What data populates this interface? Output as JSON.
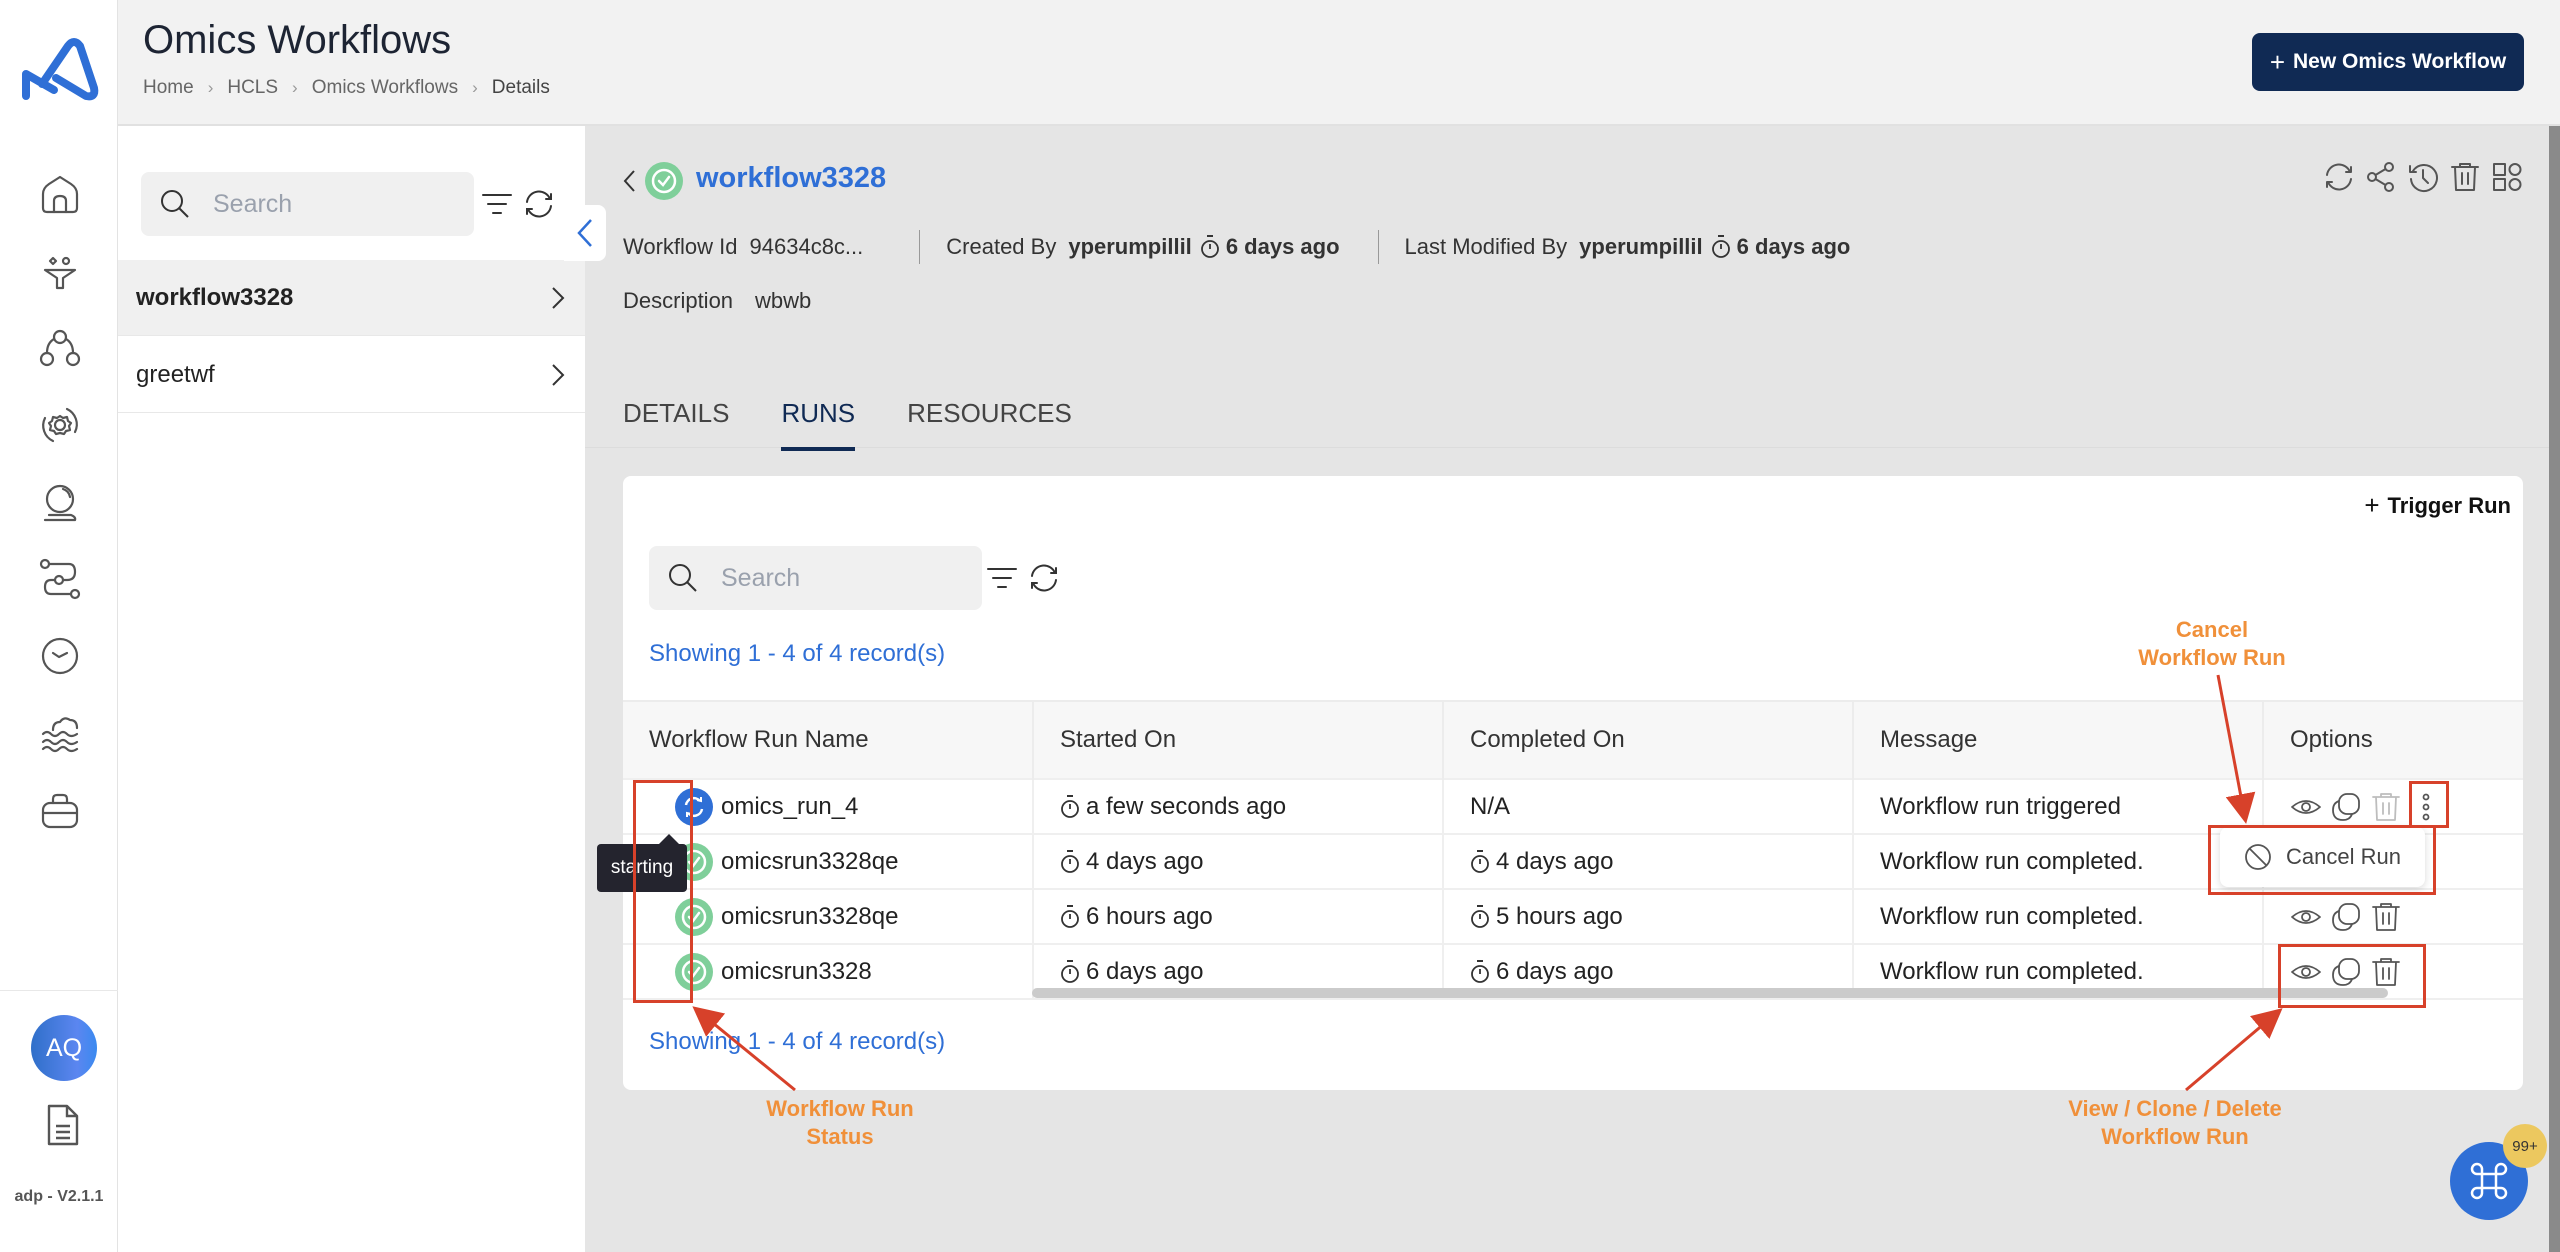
{
  "app": {
    "version": "adp - V2.1.1",
    "avatar_initials": "AQ",
    "brand_color": "#2f6fd6",
    "nav_items": [
      {
        "name": "home-icon"
      },
      {
        "name": "funnel-icon"
      },
      {
        "name": "hierarchy-icon"
      },
      {
        "name": "gear-cycle-icon"
      },
      {
        "name": "crystal-ball-icon"
      },
      {
        "name": "pipeline-icon"
      },
      {
        "name": "clock-icon"
      },
      {
        "name": "data-lake-icon"
      },
      {
        "name": "briefcase-icon"
      }
    ]
  },
  "header": {
    "title": "Omics Workflows",
    "breadcrumb": [
      "Home",
      "HCLS",
      "Omics Workflows",
      "Details"
    ],
    "new_button_label": "New Omics Workflow"
  },
  "list_panel": {
    "search_placeholder": "Search",
    "items": [
      {
        "label": "workflow3328",
        "active": true
      },
      {
        "label": "greetwf",
        "active": false
      }
    ]
  },
  "detail": {
    "title": "workflow3328",
    "status": "completed",
    "workflow_id_label": "Workflow Id",
    "workflow_id": "94634c8c...",
    "created_by_label": "Created By",
    "created_by": "yperumpillil",
    "created_ago": "6 days ago",
    "modified_by_label": "Last Modified By",
    "modified_by": "yperumpillil",
    "modified_ago": "6 days ago",
    "description_label": "Description",
    "description": "wbwb"
  },
  "tabs": [
    {
      "label": "DETAILS",
      "active": false
    },
    {
      "label": "RUNS",
      "active": true
    },
    {
      "label": "RESOURCES",
      "active": false
    }
  ],
  "runs": {
    "trigger_label": "Trigger Run",
    "search_placeholder": "Search",
    "showing_text": "Showing 1 - 4 of 4 record(s)",
    "columns": [
      "Workflow Run Name",
      "Started On",
      "Completed On",
      "Message",
      "Options"
    ],
    "rows": [
      {
        "name": "omics_run_4",
        "status": "starting",
        "started": "a few seconds ago",
        "completed": "N/A",
        "message": "Workflow run triggered",
        "delete_disabled": true,
        "has_more_menu": true
      },
      {
        "name": "omicsrun3328qe",
        "status": "completed",
        "started": "4 days ago",
        "completed": "4 days ago",
        "message": "Workflow run completed.",
        "delete_disabled": false,
        "has_more_menu": false
      },
      {
        "name": "omicsrun3328qe",
        "status": "completed",
        "started": "6 hours ago",
        "completed": "5 hours ago",
        "message": "Workflow run completed.",
        "delete_disabled": false,
        "has_more_menu": false
      },
      {
        "name": "omicsrun3328",
        "status": "completed",
        "started": "6 days ago",
        "completed": "6 days ago",
        "message": "Workflow run completed.",
        "delete_disabled": false,
        "has_more_menu": false
      }
    ],
    "tooltip": "starting",
    "menu_item": "Cancel Run"
  },
  "annotations": {
    "cancel": "Cancel\nWorkflow Run",
    "status": "Workflow Run\nStatus",
    "options": "View / Clone / Delete\nWorkflow Run",
    "color": "#f0903a",
    "box_color": "#d7412a"
  },
  "fab": {
    "badge": "99+"
  }
}
